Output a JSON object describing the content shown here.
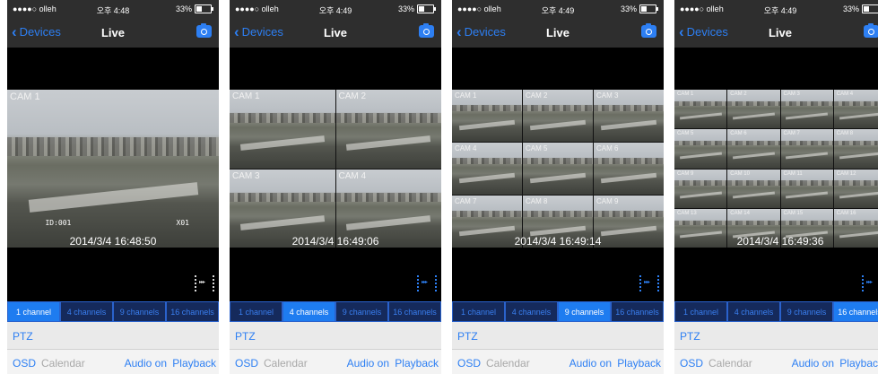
{
  "common": {
    "carrier": "●●●●○ olleh",
    "battery_pct": "33%",
    "back_label": "Devices",
    "title": "Live",
    "ptz_label": "PTZ",
    "osd_label": "OSD",
    "calendar_label": "Calendar",
    "audio_label": "Audio on",
    "playback_label": "Playback",
    "channel_tabs": [
      "1 channel",
      "4 channels",
      "9 channels",
      "16 channels"
    ],
    "id_overlay": "ID:001",
    "x01_overlay": "X01",
    "accent_color": "#2d7ff3"
  },
  "screens": [
    {
      "time": "오후 4:48",
      "timestamp": "2014/3/4 16:48:50",
      "selected_tab": 0,
      "grid": 1,
      "cams": [
        "CAM 1"
      ]
    },
    {
      "time": "오후 4:49",
      "timestamp": "2014/3/4 16:49:06",
      "selected_tab": 1,
      "grid": 2,
      "cams": [
        "CAM 1",
        "CAM 2",
        "CAM 3",
        "CAM 4"
      ]
    },
    {
      "time": "오후 4:49",
      "timestamp": "2014/3/4 16:49:14",
      "selected_tab": 2,
      "grid": 3,
      "cams": [
        "CAM 1",
        "CAM 2",
        "CAM 3",
        "CAM 4",
        "CAM 5",
        "CAM 6",
        "CAM 7",
        "CAM 8",
        "CAM 9"
      ]
    },
    {
      "time": "오후 4:49",
      "timestamp": "2014/3/4 16:49:36",
      "selected_tab": 3,
      "grid": 4,
      "cams": [
        "CAM 1",
        "CAM 2",
        "CAM 3",
        "CAM 4",
        "CAM 5",
        "CAM 6",
        "CAM 7",
        "CAM 8",
        "CAM 9",
        "CAM 10",
        "CAM 11",
        "CAM 12",
        "CAM 13",
        "CAM 14",
        "CAM 15",
        "CAM 16"
      ]
    }
  ]
}
